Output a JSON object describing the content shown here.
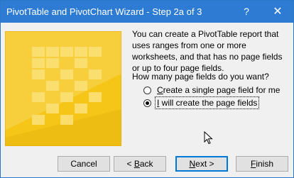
{
  "window": {
    "title": "PivotTable and PivotChart Wizard - Step 2a of 3"
  },
  "titlebar": {
    "help_glyph": "?",
    "close_glyph": "✕"
  },
  "description": "You can create a PivotTable report that uses ranges from one or more worksheets, and that has no page fields or up to four page fields.",
  "question": "How many page fields do you want?",
  "options": [
    {
      "pre": "",
      "mnemonic": "C",
      "post": "reate a single page field for me",
      "selected": false
    },
    {
      "pre": "",
      "mnemonic": "I",
      "post": " will create the page fields",
      "selected": true
    }
  ],
  "buttons": {
    "cancel": "Cancel",
    "back": {
      "pre": "< ",
      "mnemonic": "B",
      "post": "ack"
    },
    "next": {
      "pre": "",
      "mnemonic": "N",
      "post": "ext >"
    },
    "finish": {
      "pre": "",
      "mnemonic": "F",
      "post": "inish"
    }
  },
  "colors": {
    "titlebar": "#2d7bd2",
    "accent": "#0078d7",
    "art_yellow": "#f5c518"
  },
  "icons": {
    "illustration": "spreadsheet-illustration",
    "cursor": "mouse-pointer-icon"
  }
}
